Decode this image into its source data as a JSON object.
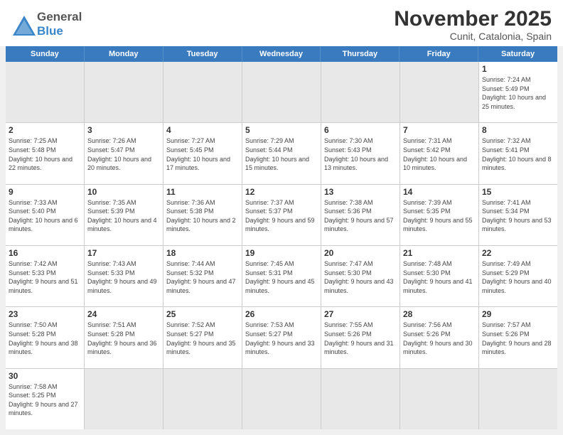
{
  "header": {
    "title": "November 2025",
    "subtitle": "Cunit, Catalonia, Spain",
    "logo_general": "General",
    "logo_blue": "Blue"
  },
  "weekdays": [
    "Sunday",
    "Monday",
    "Tuesday",
    "Wednesday",
    "Thursday",
    "Friday",
    "Saturday"
  ],
  "days": [
    {
      "num": "",
      "info": "",
      "empty": true
    },
    {
      "num": "",
      "info": "",
      "empty": true
    },
    {
      "num": "",
      "info": "",
      "empty": true
    },
    {
      "num": "",
      "info": "",
      "empty": true
    },
    {
      "num": "",
      "info": "",
      "empty": true
    },
    {
      "num": "",
      "info": "",
      "empty": true
    },
    {
      "num": "1",
      "info": "Sunrise: 7:24 AM\nSunset: 5:49 PM\nDaylight: 10 hours and 25 minutes."
    },
    {
      "num": "2",
      "info": "Sunrise: 7:25 AM\nSunset: 5:48 PM\nDaylight: 10 hours and 22 minutes."
    },
    {
      "num": "3",
      "info": "Sunrise: 7:26 AM\nSunset: 5:47 PM\nDaylight: 10 hours and 20 minutes."
    },
    {
      "num": "4",
      "info": "Sunrise: 7:27 AM\nSunset: 5:45 PM\nDaylight: 10 hours and 17 minutes."
    },
    {
      "num": "5",
      "info": "Sunrise: 7:29 AM\nSunset: 5:44 PM\nDaylight: 10 hours and 15 minutes."
    },
    {
      "num": "6",
      "info": "Sunrise: 7:30 AM\nSunset: 5:43 PM\nDaylight: 10 hours and 13 minutes."
    },
    {
      "num": "7",
      "info": "Sunrise: 7:31 AM\nSunset: 5:42 PM\nDaylight: 10 hours and 10 minutes."
    },
    {
      "num": "8",
      "info": "Sunrise: 7:32 AM\nSunset: 5:41 PM\nDaylight: 10 hours and 8 minutes."
    },
    {
      "num": "9",
      "info": "Sunrise: 7:33 AM\nSunset: 5:40 PM\nDaylight: 10 hours and 6 minutes."
    },
    {
      "num": "10",
      "info": "Sunrise: 7:35 AM\nSunset: 5:39 PM\nDaylight: 10 hours and 4 minutes."
    },
    {
      "num": "11",
      "info": "Sunrise: 7:36 AM\nSunset: 5:38 PM\nDaylight: 10 hours and 2 minutes."
    },
    {
      "num": "12",
      "info": "Sunrise: 7:37 AM\nSunset: 5:37 PM\nDaylight: 9 hours and 59 minutes."
    },
    {
      "num": "13",
      "info": "Sunrise: 7:38 AM\nSunset: 5:36 PM\nDaylight: 9 hours and 57 minutes."
    },
    {
      "num": "14",
      "info": "Sunrise: 7:39 AM\nSunset: 5:35 PM\nDaylight: 9 hours and 55 minutes."
    },
    {
      "num": "15",
      "info": "Sunrise: 7:41 AM\nSunset: 5:34 PM\nDaylight: 9 hours and 53 minutes."
    },
    {
      "num": "16",
      "info": "Sunrise: 7:42 AM\nSunset: 5:33 PM\nDaylight: 9 hours and 51 minutes."
    },
    {
      "num": "17",
      "info": "Sunrise: 7:43 AM\nSunset: 5:33 PM\nDaylight: 9 hours and 49 minutes."
    },
    {
      "num": "18",
      "info": "Sunrise: 7:44 AM\nSunset: 5:32 PM\nDaylight: 9 hours and 47 minutes."
    },
    {
      "num": "19",
      "info": "Sunrise: 7:45 AM\nSunset: 5:31 PM\nDaylight: 9 hours and 45 minutes."
    },
    {
      "num": "20",
      "info": "Sunrise: 7:47 AM\nSunset: 5:30 PM\nDaylight: 9 hours and 43 minutes."
    },
    {
      "num": "21",
      "info": "Sunrise: 7:48 AM\nSunset: 5:30 PM\nDaylight: 9 hours and 41 minutes."
    },
    {
      "num": "22",
      "info": "Sunrise: 7:49 AM\nSunset: 5:29 PM\nDaylight: 9 hours and 40 minutes."
    },
    {
      "num": "23",
      "info": "Sunrise: 7:50 AM\nSunset: 5:28 PM\nDaylight: 9 hours and 38 minutes."
    },
    {
      "num": "24",
      "info": "Sunrise: 7:51 AM\nSunset: 5:28 PM\nDaylight: 9 hours and 36 minutes."
    },
    {
      "num": "25",
      "info": "Sunrise: 7:52 AM\nSunset: 5:27 PM\nDaylight: 9 hours and 35 minutes."
    },
    {
      "num": "26",
      "info": "Sunrise: 7:53 AM\nSunset: 5:27 PM\nDaylight: 9 hours and 33 minutes."
    },
    {
      "num": "27",
      "info": "Sunrise: 7:55 AM\nSunset: 5:26 PM\nDaylight: 9 hours and 31 minutes."
    },
    {
      "num": "28",
      "info": "Sunrise: 7:56 AM\nSunset: 5:26 PM\nDaylight: 9 hours and 30 minutes."
    },
    {
      "num": "29",
      "info": "Sunrise: 7:57 AM\nSunset: 5:26 PM\nDaylight: 9 hours and 28 minutes."
    },
    {
      "num": "30",
      "info": "Sunrise: 7:58 AM\nSunset: 5:25 PM\nDaylight: 9 hours and 27 minutes."
    },
    {
      "num": "",
      "info": "",
      "empty": true
    },
    {
      "num": "",
      "info": "",
      "empty": true
    },
    {
      "num": "",
      "info": "",
      "empty": true
    },
    {
      "num": "",
      "info": "",
      "empty": true
    },
    {
      "num": "",
      "info": "",
      "empty": true
    },
    {
      "num": "",
      "info": "",
      "empty": true
    }
  ]
}
